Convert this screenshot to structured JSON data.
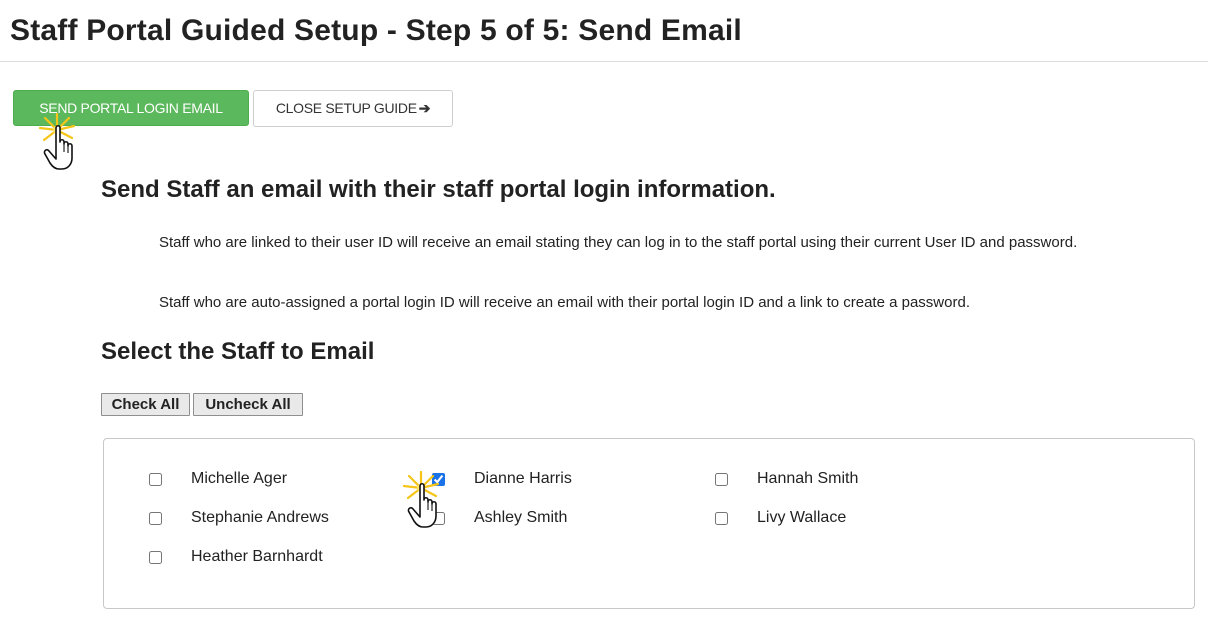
{
  "header": {
    "title": "Staff Portal Guided Setup - Step 5 of 5: Send Email"
  },
  "actions": {
    "send_label": "SEND PORTAL LOGIN EMAIL",
    "close_label": "CLOSE SETUP GUIDE",
    "close_arrow": "➔"
  },
  "intro": {
    "heading": "Send Staff an email with their staff portal login information.",
    "paragraph_1": "Staff who are linked to their user ID will receive an email stating they can log in to the staff portal using their current User ID and password.",
    "paragraph_2": "Staff who are auto-assigned a portal login ID will receive an email with their portal login ID and a link to create a password."
  },
  "selection": {
    "heading": "Select the Staff to Email",
    "check_all": "Check All",
    "uncheck_all": "Uncheck All",
    "staff": [
      {
        "name": "Michelle Ager",
        "checked": false
      },
      {
        "name": "Stephanie Andrews",
        "checked": false
      },
      {
        "name": "Heather Barnhardt",
        "checked": false
      },
      {
        "name": "Dianne Harris",
        "checked": true
      },
      {
        "name": "Ashley Smith",
        "checked": false
      },
      {
        "name": "Hannah Smith",
        "checked": false
      },
      {
        "name": "Livy Wallace",
        "checked": false
      }
    ]
  },
  "colors": {
    "primary_button": "#5cb85c",
    "checkbox_accent": "#1a73e8",
    "click_burst": "#f5c518"
  },
  "icons": {
    "cursor": "hand-pointer-icon",
    "click": "click-burst-icon"
  }
}
